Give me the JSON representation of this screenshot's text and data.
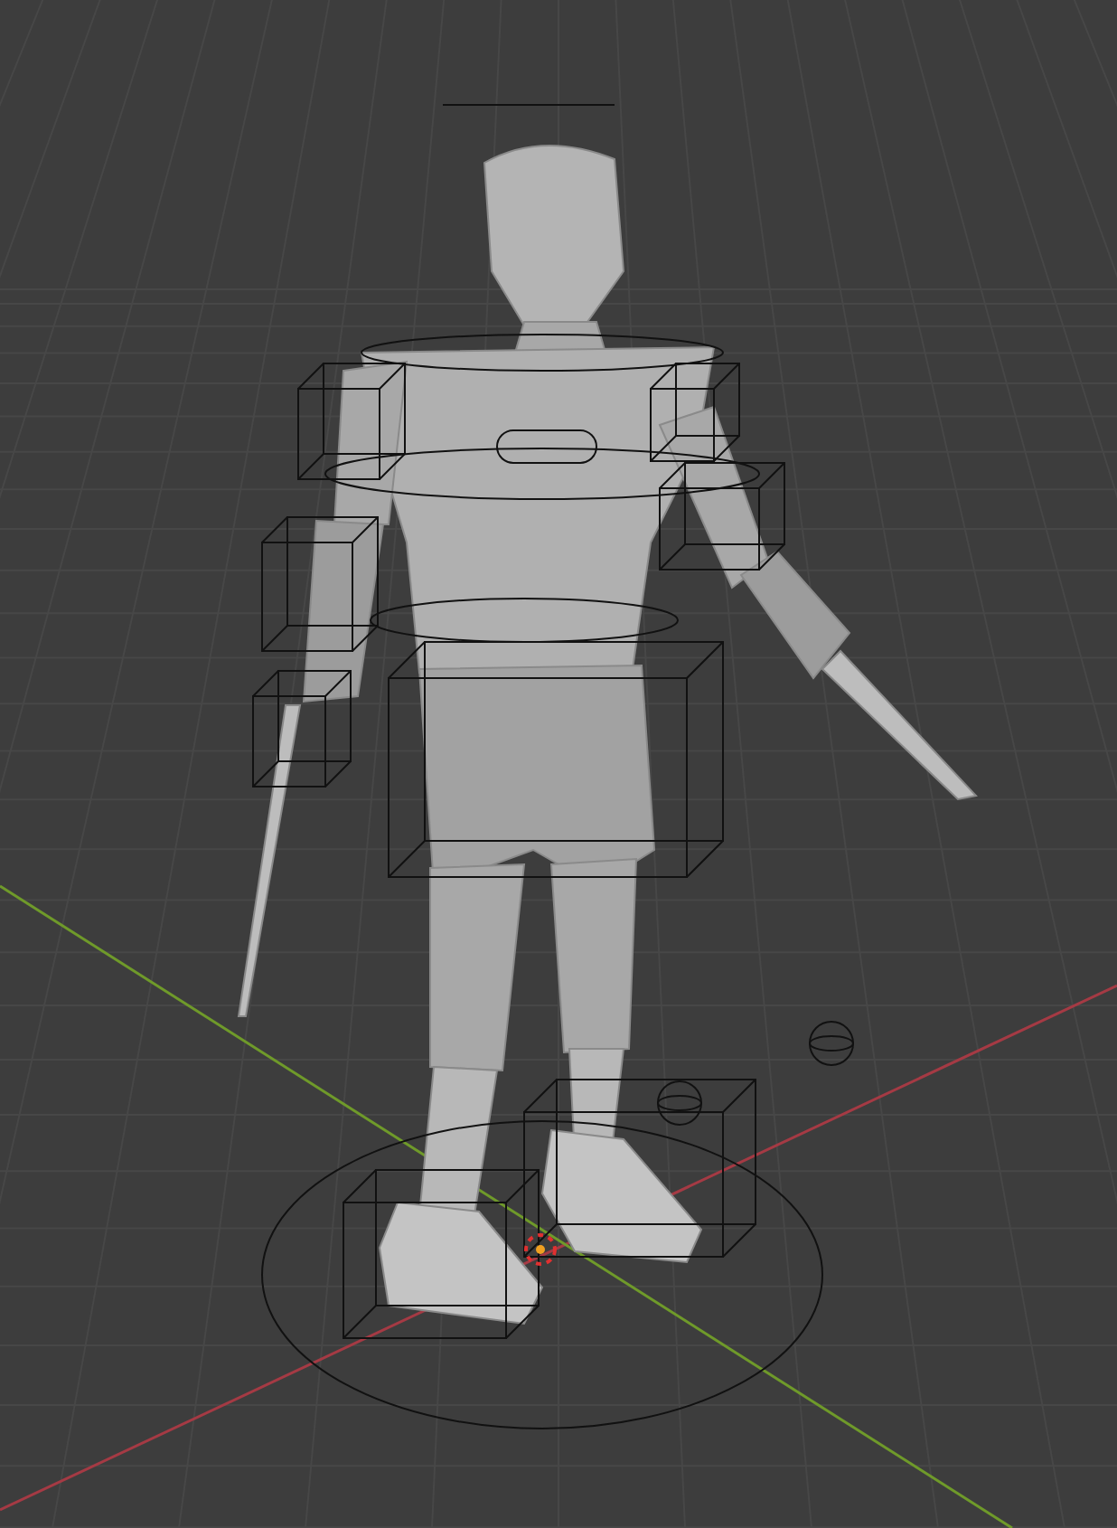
{
  "viewport": {
    "show_grid": true,
    "show_axes": true,
    "show_rig": true,
    "show_cursor": true
  }
}
